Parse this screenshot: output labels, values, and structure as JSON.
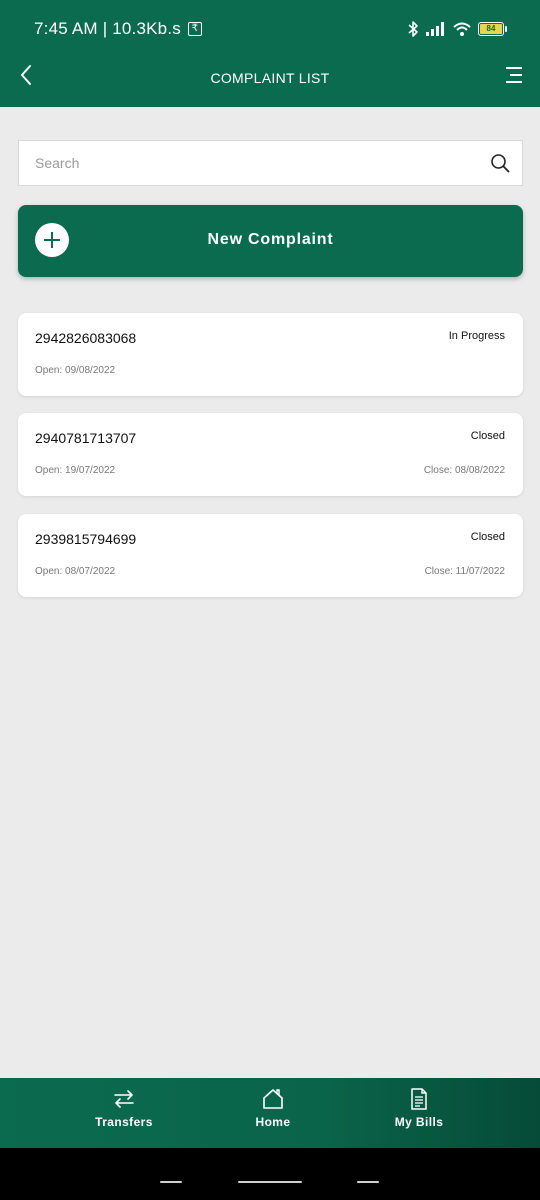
{
  "status_bar": {
    "time_speed": "7:45 AM | 10.3Kb.s",
    "rupee_glyph": "₹",
    "battery": "84"
  },
  "header": {
    "title": "COMPLAINT LIST",
    "back_icon": "chevron-left-icon",
    "menu_icon": "menu-icon"
  },
  "search": {
    "placeholder": "Search",
    "value": ""
  },
  "new_complaint": {
    "label": "New Complaint"
  },
  "complaints": [
    {
      "number": "2942826083068",
      "status": "In Progress",
      "open": "Open: 09/08/2022",
      "close": ""
    },
    {
      "number": "2940781713707",
      "status": "Closed",
      "open": "Open: 19/07/2022",
      "close": "Close: 08/08/2022"
    },
    {
      "number": "2939815794699",
      "status": "Closed",
      "open": "Open: 08/07/2022",
      "close": "Close: 11/07/2022"
    }
  ],
  "bottom_nav": {
    "transfers": "Transfers",
    "home": "Home",
    "bills": "My Bills"
  },
  "colors": {
    "brand_green": "#0b6b4e",
    "background": "#ebebeb"
  }
}
